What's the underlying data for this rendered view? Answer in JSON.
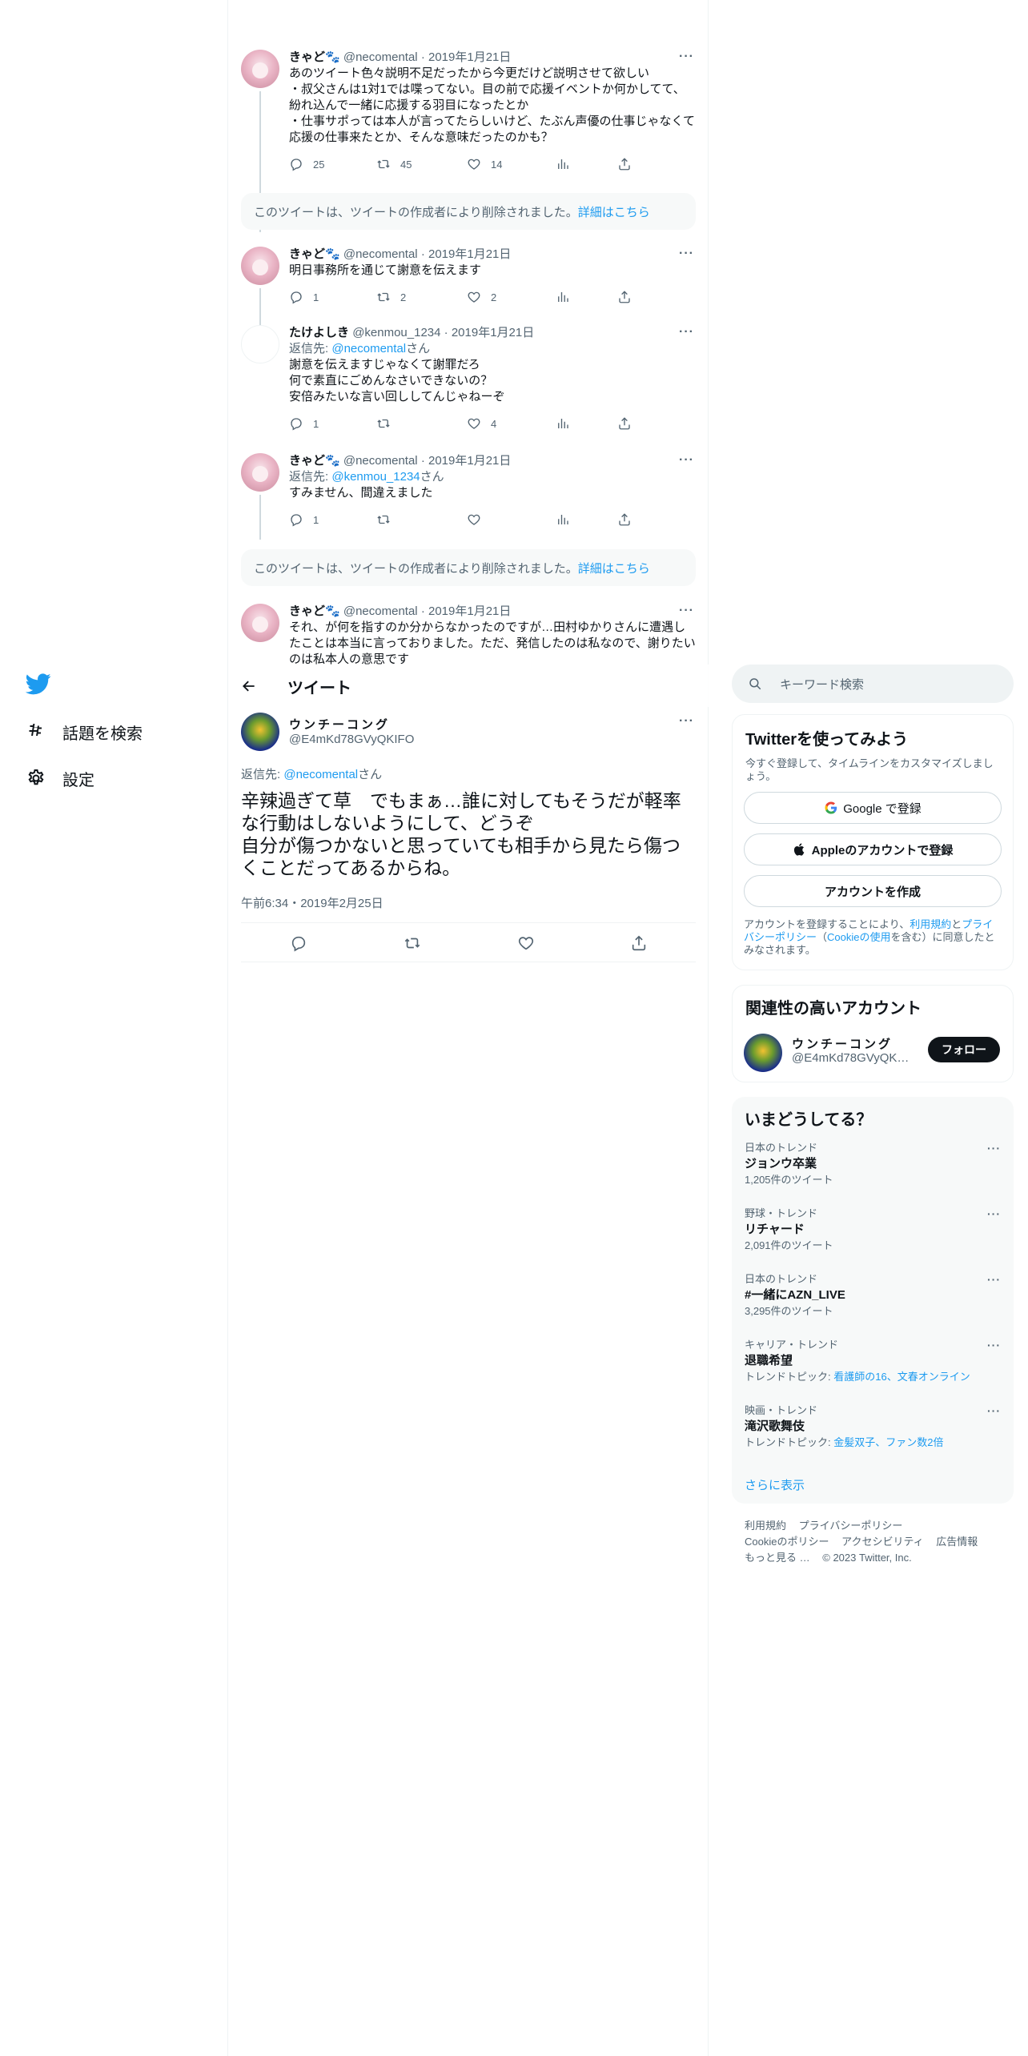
{
  "nav": {
    "explore_label": "話題を検索",
    "settings_label": "設定"
  },
  "thread": [
    {
      "name": "きゃど🐾",
      "handle": "@necomental",
      "date": "2019年1月21日",
      "text": "あのツイート色々説明不足だったから今更だけど説明させて欲しい\n・叔父さんは1対1では喋ってない。目の前で応援イベントか何かしてて、紛れ込んで一緒に応援する羽目になったとか\n・仕事サポっては本人が言ってたらしいけど、たぶん声優の仕事じゃなくて応援の仕事来たとか、そんな意味だったのかも？",
      "replies": "25",
      "retweets": "45",
      "likes": "14"
    },
    {
      "name": "きゃど🐾",
      "handle": "@necomental",
      "date": "2019年1月21日",
      "text": "明日事務所を通じて謝意を伝えます",
      "replies": "1",
      "retweets": "2",
      "likes": "2"
    },
    {
      "name": "たけよしき",
      "handle": "@kenmou_1234",
      "date": "2019年1月21日",
      "reply_prefix": "返信先: ",
      "reply_to": "@necomental",
      "reply_suffix": "さん",
      "text": "謝意を伝えますじゃなくて謝罪だろ\n何で素直にごめんなさいできないの？\n安倍みたいな言い回ししてんじゃねーぞ",
      "replies": "1",
      "retweets": "",
      "likes": "4"
    },
    {
      "name": "きゃど🐾",
      "handle": "@necomental",
      "date": "2019年1月21日",
      "reply_prefix": "返信先: ",
      "reply_to": "@kenmou_1234",
      "reply_suffix": "さん",
      "text": "すみません、間違えました",
      "replies": "1",
      "retweets": "",
      "likes": ""
    },
    {
      "name": "きゃど🐾",
      "handle": "@necomental",
      "date": "2019年1月21日",
      "text": "それ、が何を指すのか分からなかったのですが…田村ゆかりさんに遭遇したことは本当に言っておりました。ただ、発信したのは私なので、謝りたいのは私本人の意思です"
    }
  ],
  "deleted_notice": {
    "text": "このツイートは、ツイートの作成者により削除されました。",
    "link": "詳細はこちら"
  },
  "topbar": {
    "title": "ツイート"
  },
  "focal": {
    "name": "ウンチーコング",
    "handle": "@E4mKd78GVyQKIFO",
    "reply_prefix": "返信先: ",
    "reply_to": "@necomental",
    "reply_suffix": "さん",
    "text": "辛辣過ぎて草　でもまぁ…誰に対してもそうだが軽率な行動はしないようにして、どうぞ\n自分が傷つかないと思っていても相手から見たら傷つくことだってあるからね。",
    "timestamp": "午前6:34・2019年2月25日"
  },
  "search": {
    "placeholder": "キーワード検索"
  },
  "signup": {
    "title": "Twitterを使ってみよう",
    "subtitle": "今すぐ登録して、タイムラインをカスタマイズしましょう。",
    "google_label": "Google で登録",
    "apple_label": "Appleのアカウントで登録",
    "create_label": "アカウントを作成",
    "legal_prefix": "アカウントを登録することにより、",
    "legal_tos": "利用規約",
    "legal_and": "と",
    "legal_privacy": "プライバシーポリシー",
    "legal_paren_open": "（",
    "legal_cookie": "Cookieの使用",
    "legal_suffix": "を含む）に同意したとみなされます。"
  },
  "related": {
    "title": "関連性の高いアカウント",
    "name": "ウンチーコング",
    "handle": "@E4mKd78GVyQKIFO",
    "follow_label": "フォロー"
  },
  "trends": {
    "title": "いまどうしてる？",
    "items": [
      {
        "meta": "日本のトレンド",
        "name": "ジョンウ卒業",
        "count": "1,205件のツイート"
      },
      {
        "meta": "野球・トレンド",
        "name": "リチャード",
        "count": "2,091件のツイート"
      },
      {
        "meta": "日本のトレンド",
        "name": "#一緒にAZN_LIVE",
        "count": "3,295件のツイート"
      },
      {
        "meta": "キャリア・トレンド",
        "name": "退職希望",
        "topic_prefix": "トレンドトピック: ",
        "topics": "看護師の16、文春オンライン"
      },
      {
        "meta": "映画・トレンド",
        "name": "滝沢歌舞伎",
        "topic_prefix": "トレンドトピック: ",
        "topics": "金髪双子、ファン数2倍"
      }
    ],
    "show_more": "さらに表示"
  },
  "footer": {
    "tos": "利用規約",
    "privacy": "プライバシーポリシー",
    "cookie": "Cookieのポリシー",
    "accessibility": "アクセシビリティ",
    "ads": "広告情報",
    "more": "もっと見る …",
    "copyright": "© 2023 Twitter, Inc."
  },
  "colors": {
    "accent": "#1d9bf0",
    "text": "#0f1419",
    "secondary": "#536471",
    "border": "#eff3f4"
  }
}
